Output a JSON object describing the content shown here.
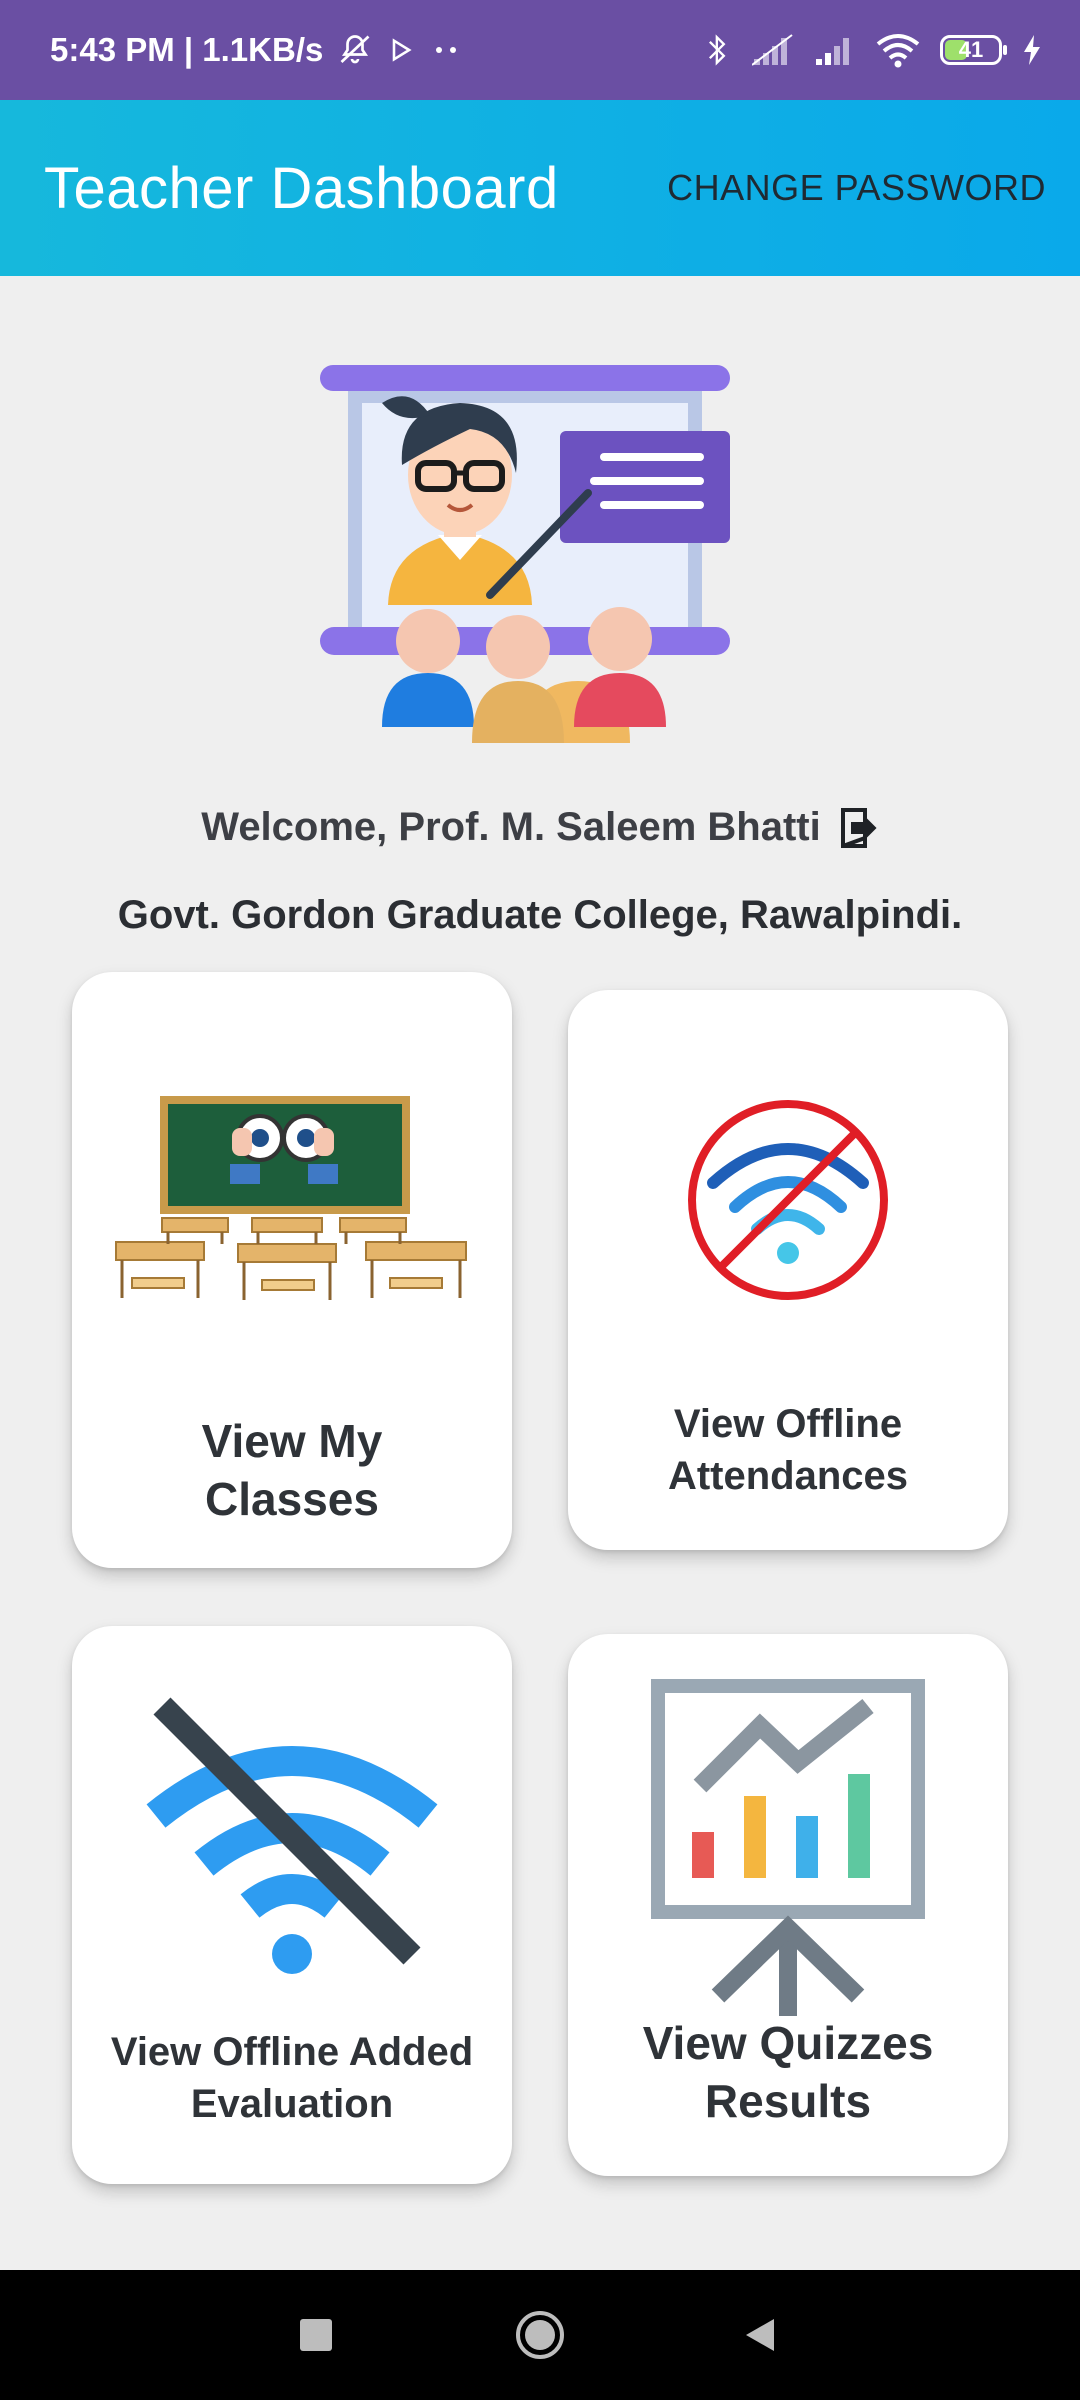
{
  "status_bar": {
    "time_speed": "5:43 PM | 1.1KB/s",
    "battery_level": "41",
    "icons": [
      "mute-icon",
      "play-icon",
      "more-icon",
      "bluetooth-icon",
      "signal-icon",
      "signal-icon",
      "wifi-icon",
      "battery-icon",
      "charging-icon"
    ]
  },
  "app_bar": {
    "title": "Teacher Dashboard",
    "action_label": "CHANGE PASSWORD"
  },
  "profile": {
    "welcome": "Welcome, Prof. M. Saleem Bhatti",
    "college": "Govt. Gordon Graduate College, Rawalpindi."
  },
  "cards": [
    {
      "label": "View My Classes",
      "icon": "classroom-binoculars-icon"
    },
    {
      "label": "View Offline Attendances",
      "icon": "no-wifi-icon"
    },
    {
      "label": "View Offline Added Evaluation",
      "icon": "wifi-off-icon"
    },
    {
      "label": "View Quizzes Results",
      "icon": "chart-presentation-icon"
    }
  ],
  "colors": {
    "status_bar": "#6a4fa3",
    "app_bar_start": "#16b8dc",
    "app_bar_end": "#0aa9ea",
    "background": "#efefef"
  }
}
